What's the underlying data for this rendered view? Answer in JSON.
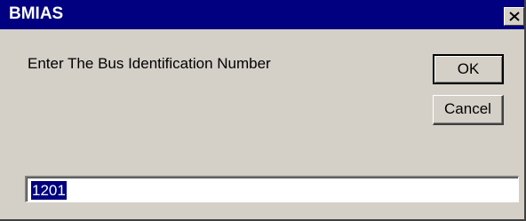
{
  "window": {
    "title": "BMIAS",
    "close_glyph": "close-icon"
  },
  "prompt": {
    "text": "Enter The Bus Identification Number"
  },
  "buttons": {
    "ok_label": "OK",
    "cancel_label": "Cancel"
  },
  "input": {
    "value": "1201"
  },
  "colors": {
    "titlebar": "#000080",
    "dialog_bg": "#d4d0c8",
    "selection": "#000080"
  }
}
